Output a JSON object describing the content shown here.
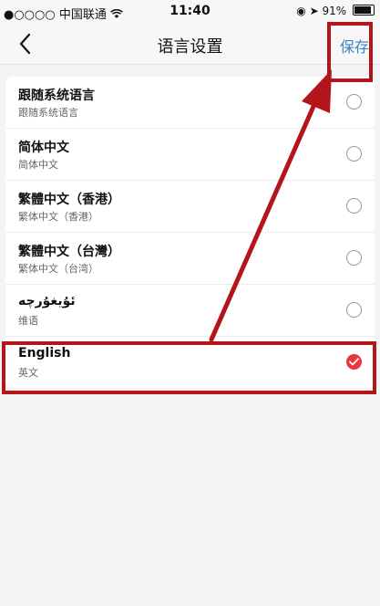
{
  "status_bar": {
    "carrier": "●○○○○ 中国联通",
    "time": "11:40",
    "battery": "91%"
  },
  "nav": {
    "title": "语言设置",
    "save_label": "保存"
  },
  "languages": [
    {
      "name": "跟随系统语言",
      "sub": "跟随系统语言",
      "selected": false
    },
    {
      "name": "简体中文",
      "sub": "简体中文",
      "selected": false
    },
    {
      "name": "繁體中文（香港）",
      "sub": "繁体中文（香港）",
      "selected": false
    },
    {
      "name": "繁體中文（台灣）",
      "sub": "繁体中文（台湾）",
      "selected": false
    },
    {
      "name": "ئۇيغۇرچە",
      "sub": "维语",
      "selected": false
    },
    {
      "name": "English",
      "sub": "英文",
      "selected": true
    }
  ],
  "colors": {
    "accent": "#3b82c6",
    "selected": "#e8373d",
    "annotation": "#b3151b"
  }
}
